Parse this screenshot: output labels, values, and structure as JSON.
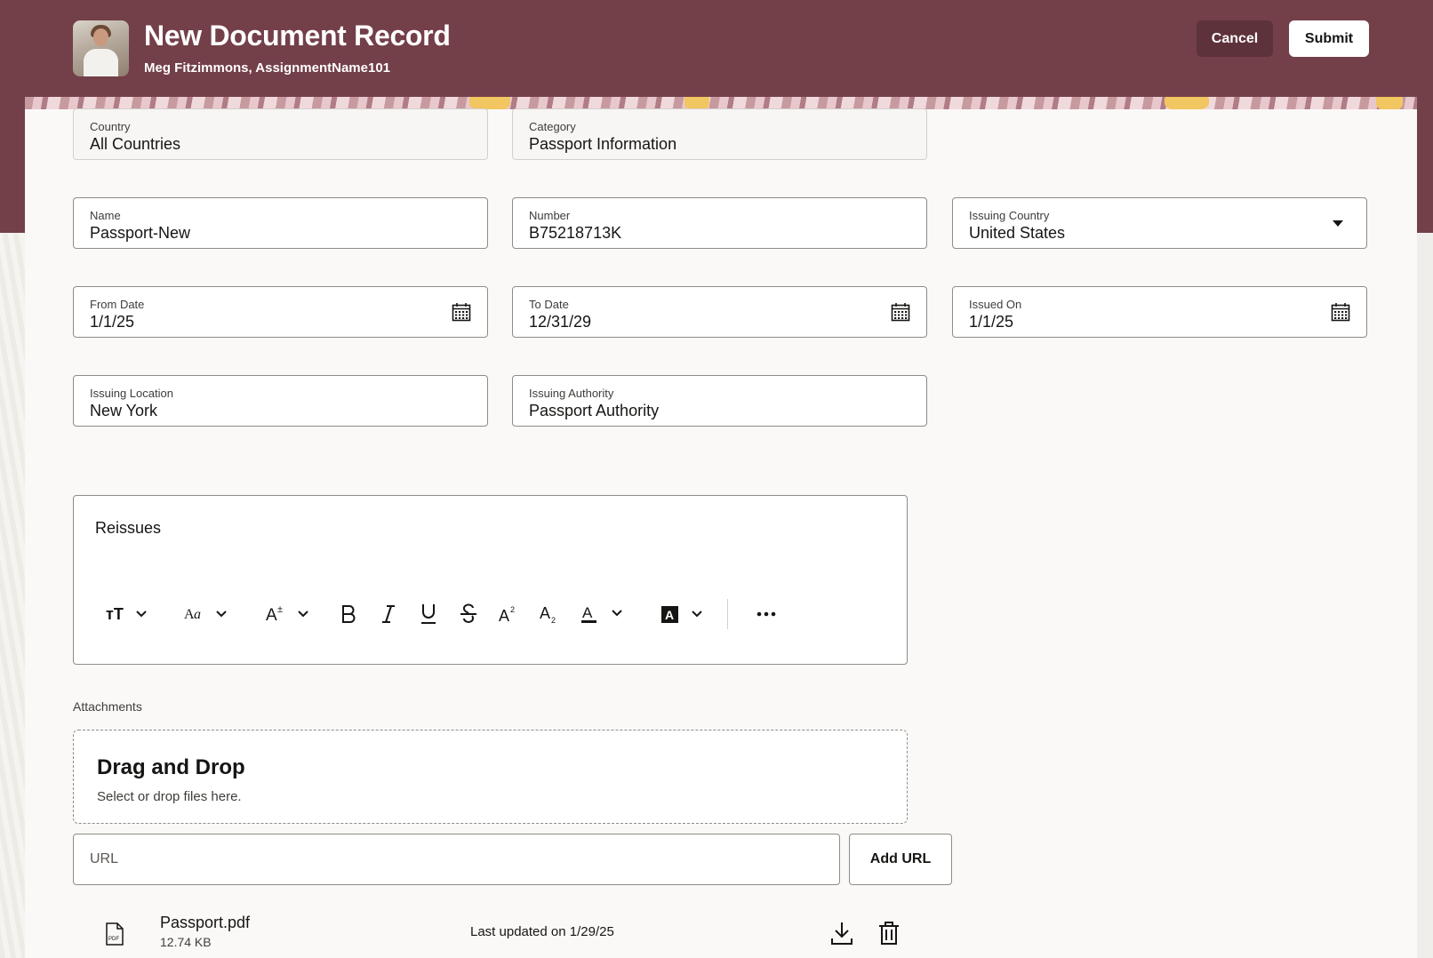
{
  "header": {
    "title": "New Document Record",
    "subtitle": "Meg Fitzimmons, AssignmentName101",
    "cancel_label": "Cancel",
    "submit_label": "Submit"
  },
  "colors": {
    "brand": "#733f49",
    "accent": "#f2c660"
  },
  "form": {
    "country": {
      "label": "Country",
      "value": "All Countries"
    },
    "category": {
      "label": "Category",
      "value": "Passport Information"
    },
    "name": {
      "label": "Name",
      "value": "Passport-New"
    },
    "number": {
      "label": "Number",
      "value": "B75218713K"
    },
    "issuing_country": {
      "label": "Issuing Country",
      "value": "United States"
    },
    "from_date": {
      "label": "From Date",
      "value": "1/1/25"
    },
    "to_date": {
      "label": "To Date",
      "value": "12/31/29"
    },
    "issued_on": {
      "label": "Issued On",
      "value": "1/1/25"
    },
    "issuing_location": {
      "label": "Issuing Location",
      "value": "New York"
    },
    "issuing_authority": {
      "label": "Issuing Authority",
      "value": "Passport Authority"
    },
    "reissues": {
      "label": "Reissues"
    }
  },
  "toolbar": {
    "items": [
      "text-size-icon",
      "font-family-icon",
      "font-size-icon",
      "bold-icon",
      "italic-icon",
      "underline-icon",
      "strikethrough-icon",
      "superscript-icon",
      "subscript-icon",
      "font-color-icon",
      "highlight-color-icon",
      "more-icon"
    ]
  },
  "attachments": {
    "label": "Attachments",
    "drop_title": "Drag and Drop",
    "drop_hint": "Select or drop files here.",
    "url_placeholder": "URL",
    "add_url_label": "Add URL",
    "files": [
      {
        "name": "Passport.pdf",
        "size": "12.74 KB",
        "updated": "Last updated on 1/29/25"
      }
    ]
  }
}
